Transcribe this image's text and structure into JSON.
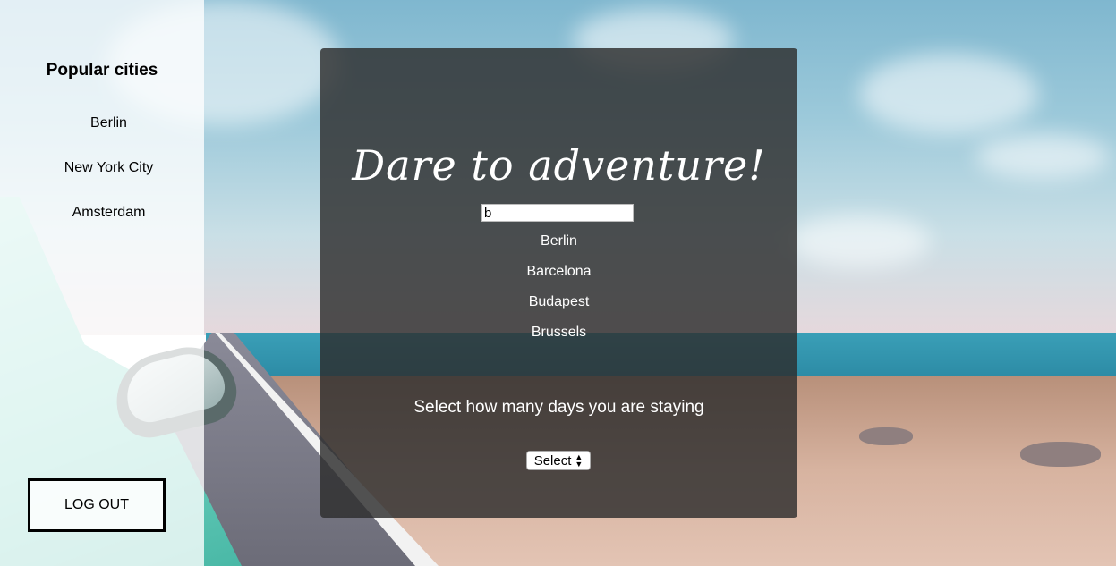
{
  "sidebar": {
    "title": "Popular cities",
    "cities": [
      "Berlin",
      "New York City",
      "Amsterdam"
    ],
    "logout_label": "LOG OUT"
  },
  "main": {
    "headline": "Dare to adventure!",
    "search": {
      "value": "b",
      "placeholder": ""
    },
    "suggestions": [
      "Berlin",
      "Barcelona",
      "Budapest",
      "Brussels"
    ],
    "days_label": "Select how many days you are staying",
    "days_select": {
      "selected": "Select"
    }
  },
  "icons": {
    "select_arrows": "select-arrows-icon"
  },
  "colors": {
    "panel": "#2d2d2d",
    "sidebar": "#ffffff"
  }
}
